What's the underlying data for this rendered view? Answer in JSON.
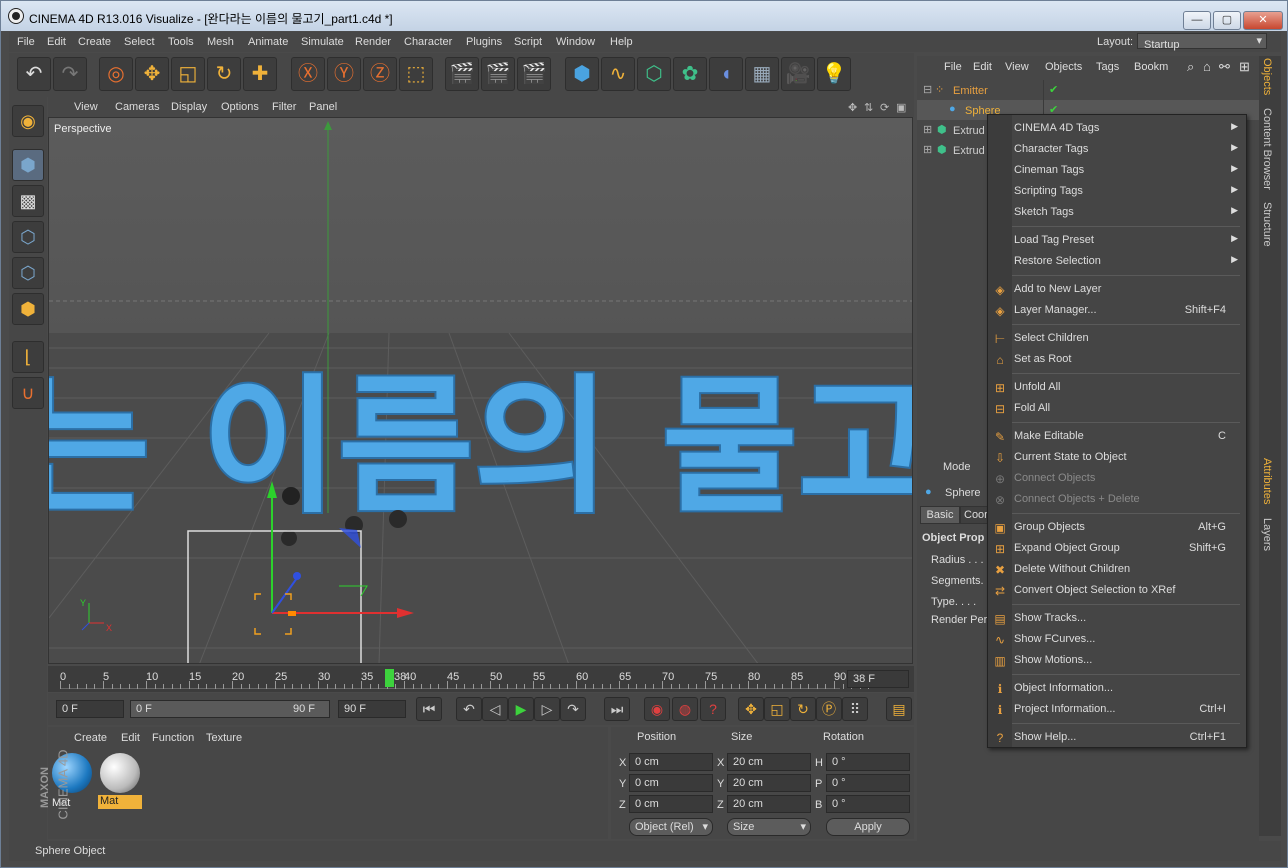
{
  "window": {
    "title": "CINEMA 4D R13.016 Visualize - [완다라는 이름의 물고기_part1.c4d *]",
    "min": "—",
    "max": "▢",
    "close": "✕"
  },
  "menubar": {
    "items": [
      "File",
      "Edit",
      "Create",
      "Select",
      "Tools",
      "Mesh",
      "Animate",
      "Simulate",
      "Render",
      "Character",
      "Plugins",
      "Script",
      "Window",
      "Help"
    ],
    "layout_label": "Layout:",
    "layout_value": "Startup"
  },
  "viewport": {
    "menu": [
      "View",
      "Cameras",
      "Display",
      "Options",
      "Filter",
      "Panel"
    ],
    "label": "Perspective",
    "scene_text": "나는 이름의 물고기",
    "axis_x": "X",
    "axis_y": "Y"
  },
  "timeline": {
    "ticks": [
      "0",
      "5",
      "10",
      "15",
      "20",
      "25",
      "30",
      "35",
      "40",
      "45",
      "50",
      "55",
      "60",
      "65",
      "70",
      "75",
      "80",
      "85",
      "90"
    ],
    "current_marker": "38",
    "current_frame": "38 F"
  },
  "transport": {
    "start": "0 F",
    "range_start": "0 F",
    "range_end": "90 F",
    "end": "90 F"
  },
  "materials": {
    "menu": [
      "Create",
      "Edit",
      "Function",
      "Texture"
    ],
    "items": [
      {
        "name": "Mat",
        "selected": false
      },
      {
        "name": "Mat",
        "selected": true
      }
    ],
    "brand_top": "MAXON",
    "brand_bottom": "CINEMA 4D"
  },
  "coords": {
    "headers": [
      "Position",
      "Size",
      "Rotation"
    ],
    "rows": [
      {
        "a": "X",
        "pos": "0 cm",
        "b": "X",
        "size": "20 cm",
        "c": "H",
        "rot": "0 °"
      },
      {
        "a": "Y",
        "pos": "0 cm",
        "b": "Y",
        "size": "20 cm",
        "c": "P",
        "rot": "0 °"
      },
      {
        "a": "Z",
        "pos": "0 cm",
        "b": "Z",
        "size": "20 cm",
        "c": "B",
        "rot": "0 °"
      }
    ],
    "mode": "Object (Rel)",
    "size_mode": "Size",
    "apply": "Apply"
  },
  "status": "Sphere Object",
  "objects": {
    "menu": [
      "File",
      "Edit",
      "View",
      "Objects",
      "Tags",
      "Bookm"
    ],
    "tree": [
      {
        "name": "Emitter",
        "color": "#e8a040"
      },
      {
        "name": "Sphere",
        "color": "#f0b23a"
      },
      {
        "name": "Extrud",
        "color": "#cfcfcf"
      },
      {
        "name": "Extrud",
        "color": "#cfcfcf"
      }
    ]
  },
  "attributes": {
    "mode": "Mode",
    "object": "Sphere",
    "tabs": [
      "Basic",
      "Coor"
    ],
    "section": "Object Prop",
    "props": [
      "Radius . . .",
      "Segments.",
      "Type. . . .",
      "Render Per"
    ]
  },
  "side_tabs": [
    "Objects",
    "Content Browser",
    "Structure",
    "Attributes",
    "Layers"
  ],
  "context_menu": [
    {
      "label": "CINEMA 4D Tags",
      "sub": true,
      "icon": ""
    },
    {
      "label": "Character Tags",
      "sub": true,
      "icon": ""
    },
    {
      "label": "Cineman Tags",
      "sub": true,
      "icon": ""
    },
    {
      "label": "Scripting Tags",
      "sub": true,
      "icon": ""
    },
    {
      "label": "Sketch Tags",
      "sub": true,
      "icon": ""
    },
    {
      "sep": true
    },
    {
      "label": "Load Tag Preset",
      "sub": true,
      "icon": ""
    },
    {
      "label": "Restore Selection",
      "sub": true,
      "icon": ""
    },
    {
      "sep": true
    },
    {
      "label": "Add to New Layer",
      "icon": "layer-add-icon"
    },
    {
      "label": "Layer Manager...",
      "shortcut": "Shift+F4",
      "icon": "layer-manager-icon"
    },
    {
      "sep": true
    },
    {
      "label": "Select Children",
      "icon": "select-children-icon"
    },
    {
      "label": "Set as Root",
      "icon": "home-icon"
    },
    {
      "sep": true
    },
    {
      "label": "Unfold All",
      "icon": "unfold-icon"
    },
    {
      "label": "Fold All",
      "icon": "fold-icon"
    },
    {
      "sep": true
    },
    {
      "label": "Make Editable",
      "shortcut": "C",
      "icon": "make-editable-icon"
    },
    {
      "label": "Current State to Object",
      "icon": "state-object-icon"
    },
    {
      "label": "Connect Objects",
      "disabled": true,
      "icon": "connect-icon"
    },
    {
      "label": "Connect Objects + Delete",
      "disabled": true,
      "icon": "connect-delete-icon"
    },
    {
      "sep": true
    },
    {
      "label": "Group Objects",
      "shortcut": "Alt+G",
      "icon": "group-icon"
    },
    {
      "label": "Expand Object Group",
      "shortcut": "Shift+G",
      "icon": "expand-group-icon"
    },
    {
      "label": "Delete Without Children",
      "icon": "delete-icon"
    },
    {
      "label": "Convert Object Selection to XRef",
      "icon": "xref-icon"
    },
    {
      "sep": true
    },
    {
      "label": "Show Tracks...",
      "icon": "tracks-icon"
    },
    {
      "label": "Show FCurves...",
      "icon": "fcurves-icon"
    },
    {
      "label": "Show Motions...",
      "icon": "motions-icon"
    },
    {
      "sep": true
    },
    {
      "label": "Object Information...",
      "icon": "info-icon"
    },
    {
      "label": "Project Information...",
      "shortcut": "Ctrl+I",
      "icon": "project-info-icon"
    },
    {
      "sep": true
    },
    {
      "label": "Show Help...",
      "shortcut": "Ctrl+F1",
      "icon": "help-icon"
    }
  ]
}
